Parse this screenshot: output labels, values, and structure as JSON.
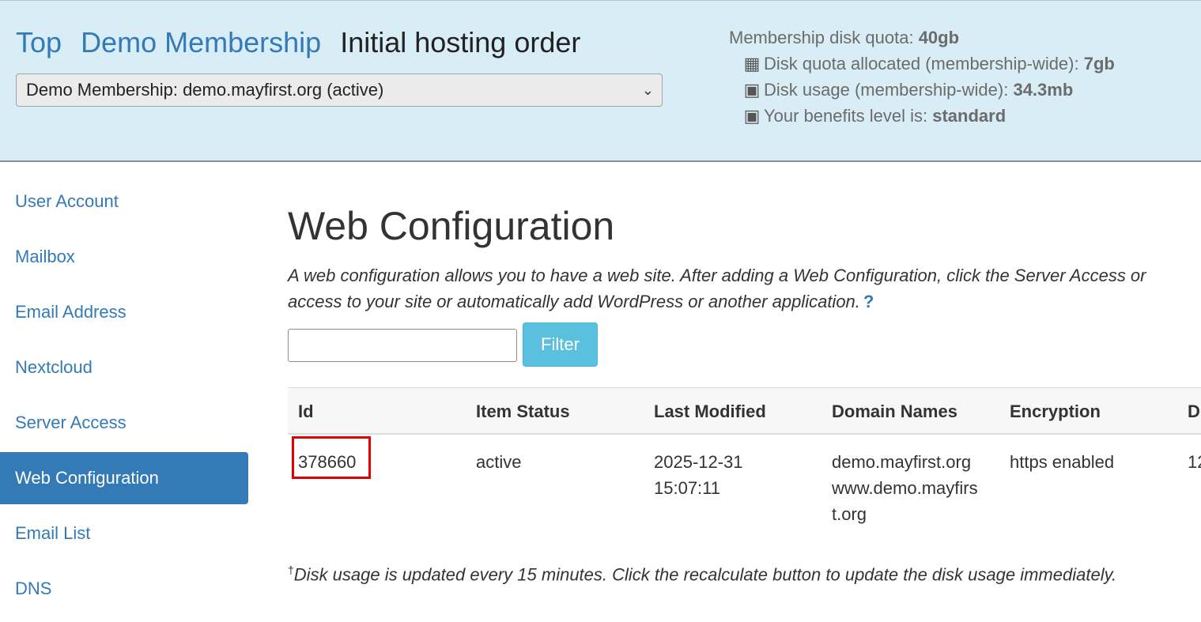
{
  "header": {
    "breadcrumb": {
      "top": "Top",
      "membership": "Demo Membership",
      "current": "Initial hosting order"
    },
    "membership_select": {
      "value": "Demo Membership: demo.mayfirst.org (active)"
    },
    "quota": {
      "disk_quota_label": "Membership disk quota:",
      "disk_quota_value": "40gb",
      "allocated_label": "Disk quota allocated (membership-wide):",
      "allocated_value": "7gb",
      "usage_label": "Disk usage (membership-wide):",
      "usage_value": "34.3mb",
      "benefits_label": "Your benefits level is:",
      "benefits_value": "standard"
    }
  },
  "sidebar": {
    "items": [
      {
        "label": "User Account"
      },
      {
        "label": "Mailbox"
      },
      {
        "label": "Email Address"
      },
      {
        "label": "Nextcloud"
      },
      {
        "label": "Server Access"
      },
      {
        "label": "Web Configuration",
        "active": true
      },
      {
        "label": "Email List"
      },
      {
        "label": "DNS"
      }
    ]
  },
  "main": {
    "title": "Web Configuration",
    "description_line1": "A web configuration allows you to have a web site. After adding a Web Configuration, click the Server Access or",
    "description_line2": "access to your site or automatically add WordPress or another application.",
    "help": "?",
    "filter": {
      "value": "",
      "button_label": "Filter"
    },
    "table": {
      "columns": [
        "Id",
        "Item Status",
        "Last Modified",
        "Domain Names",
        "Encryption",
        "D"
      ],
      "rows": [
        {
          "id": "378660",
          "status": "active",
          "modified_date": "2025-12-31",
          "modified_time": "15:07:11",
          "domain1": "demo.mayfirst.org",
          "domain2a": "www.demo.mayfirs",
          "domain2b": "t.org",
          "encryption": "https enabled",
          "extra": "12"
        }
      ]
    },
    "footnote_mark": "†",
    "footnote": "Disk usage is updated every 15 minutes. Click the recalculate button to update the disk usage immediately."
  },
  "colors": {
    "header_bg": "#d9edf7",
    "link": "#337ab7",
    "active_bg": "#337ab7",
    "filter_btn": "#5bc0de",
    "highlight": "#e00000"
  }
}
